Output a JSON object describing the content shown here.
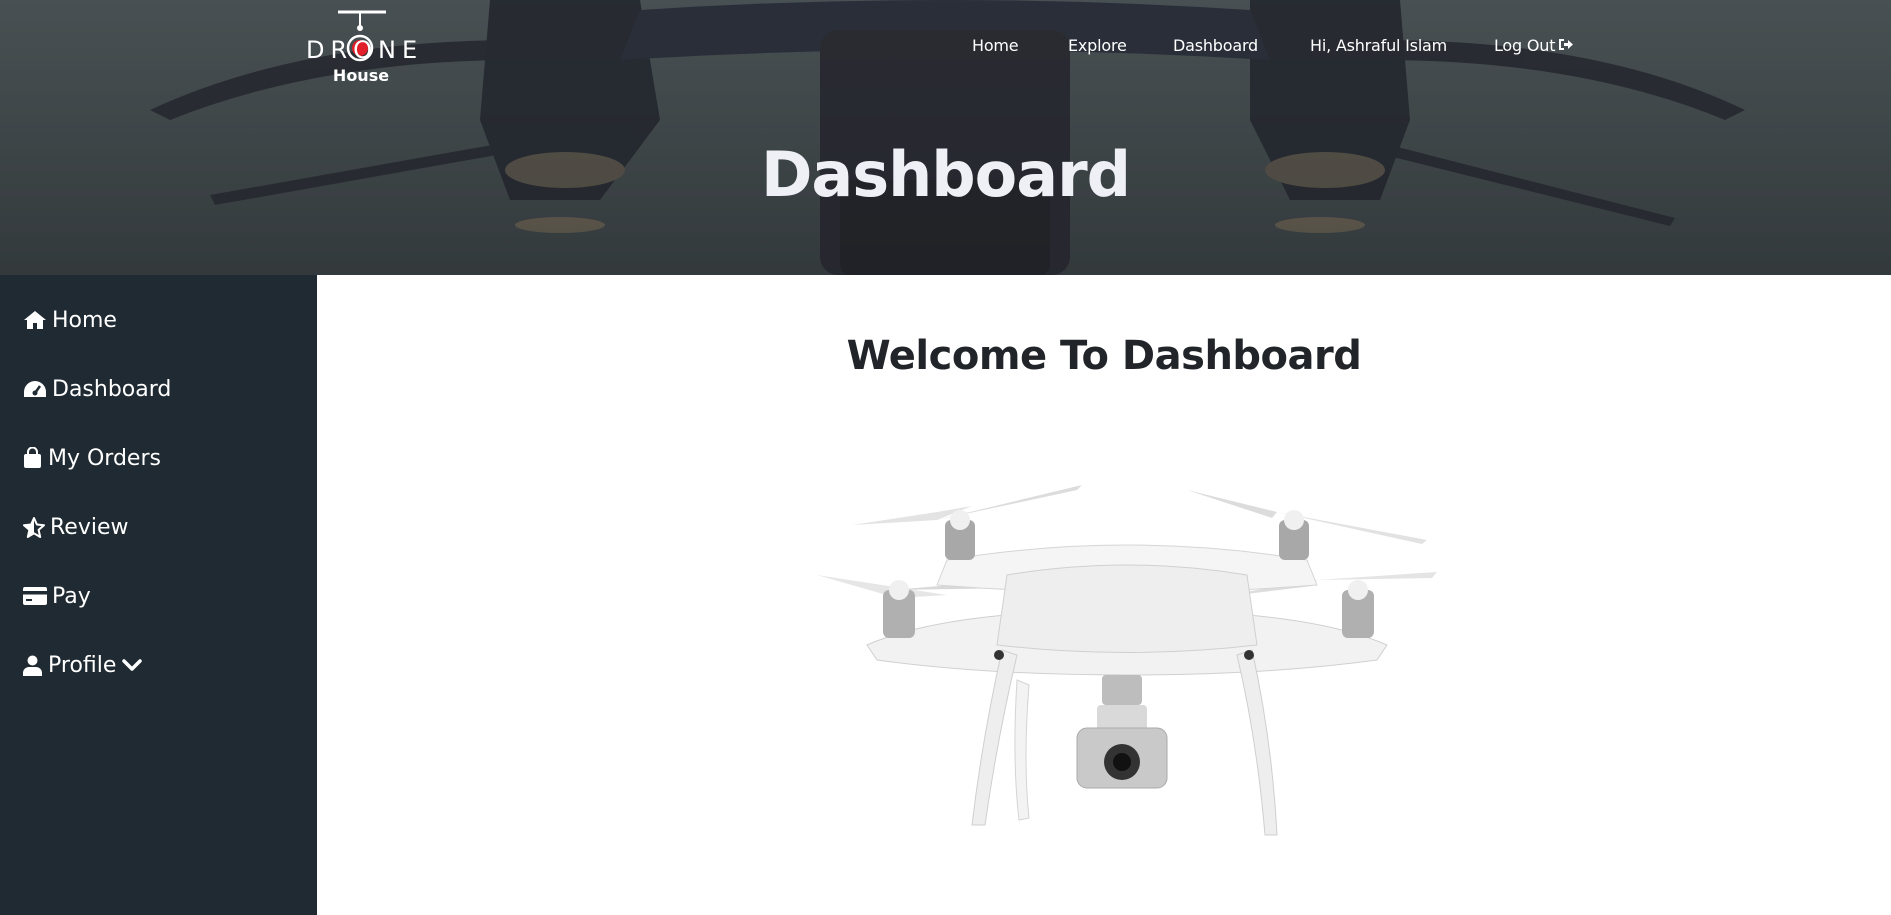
{
  "brand": {
    "logo_word": "DRONE",
    "logo_sub": "House"
  },
  "nav": {
    "home": "Home",
    "explore": "Explore",
    "dashboard": "Dashboard",
    "greeting": "Hi, Ashraful Islam",
    "logout": "Log Out"
  },
  "hero": {
    "title": "Dashboard"
  },
  "sidebar": {
    "items": [
      {
        "label": "Home",
        "icon": "home-icon"
      },
      {
        "label": "Dashboard",
        "icon": "tachometer-icon"
      },
      {
        "label": "My Orders",
        "icon": "shopping-bag-icon"
      },
      {
        "label": "Review",
        "icon": "star-icon"
      },
      {
        "label": "Pay",
        "icon": "credit-card-icon"
      },
      {
        "label": "Profile",
        "icon": "user-icon"
      }
    ]
  },
  "main": {
    "welcome": "Welcome To Dashboard"
  },
  "colors": {
    "sidebar_bg": "#1f2a32",
    "heading": "#212529",
    "hero_title": "#eef0f6",
    "logo_accent": "#e01f2a"
  }
}
